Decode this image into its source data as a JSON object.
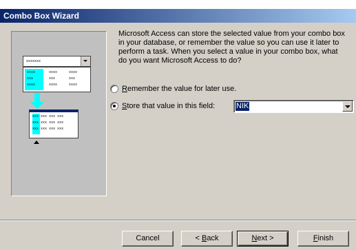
{
  "window": {
    "title": "Combo Box Wizard"
  },
  "intro": {
    "line1": "Microsoft Access can store the selected value from your combo box",
    "line2": "in your database, or remember the value so you can use it later to",
    "line3": "perform a task.  When you select a value in your combo box, what",
    "line4": "do you want Microsoft Access to do?"
  },
  "options": {
    "remember": {
      "accel": "R",
      "rest": "emember the value for later use.",
      "selected": false
    },
    "store": {
      "accel": "S",
      "rest": "tore that value in this field:",
      "selected": true
    }
  },
  "field_select": {
    "value": "NIK"
  },
  "buttons": {
    "cancel": "Cancel",
    "back": {
      "pre": "< ",
      "accel": "B",
      "rest": "ack"
    },
    "next": {
      "accel": "N",
      "rest": "ext >"
    },
    "finish": {
      "accel": "F",
      "rest": "inish"
    }
  },
  "illustration": {
    "combo_text": "xxxxxxx",
    "cell": "xxxx",
    "cell3": "xxx"
  },
  "colors": {
    "title_start": "#0a246a",
    "title_end": "#a6caf0",
    "highlight": "#00ffff",
    "face": "#d4d0c8"
  }
}
